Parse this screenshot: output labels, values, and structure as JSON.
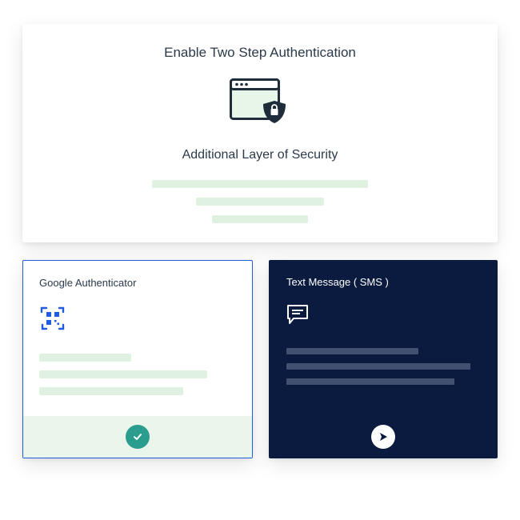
{
  "top": {
    "title": "Enable  Two Step Authentication",
    "subtitle": "Additional Layer of Security",
    "placeholder_widths": [
      270,
      160,
      120
    ]
  },
  "options": {
    "google_auth": {
      "title": "Google Authenticator",
      "placeholder_widths": [
        115,
        210,
        180
      ],
      "selected": true
    },
    "sms": {
      "title": "Text Message ( SMS )",
      "placeholder_widths": [
        165,
        230,
        210
      ]
    }
  },
  "colors": {
    "accent_blue": "#1f5ce0",
    "dark_navy": "#0a1b3f",
    "mint": "#dff2e2",
    "teal": "#2a9d8f"
  }
}
